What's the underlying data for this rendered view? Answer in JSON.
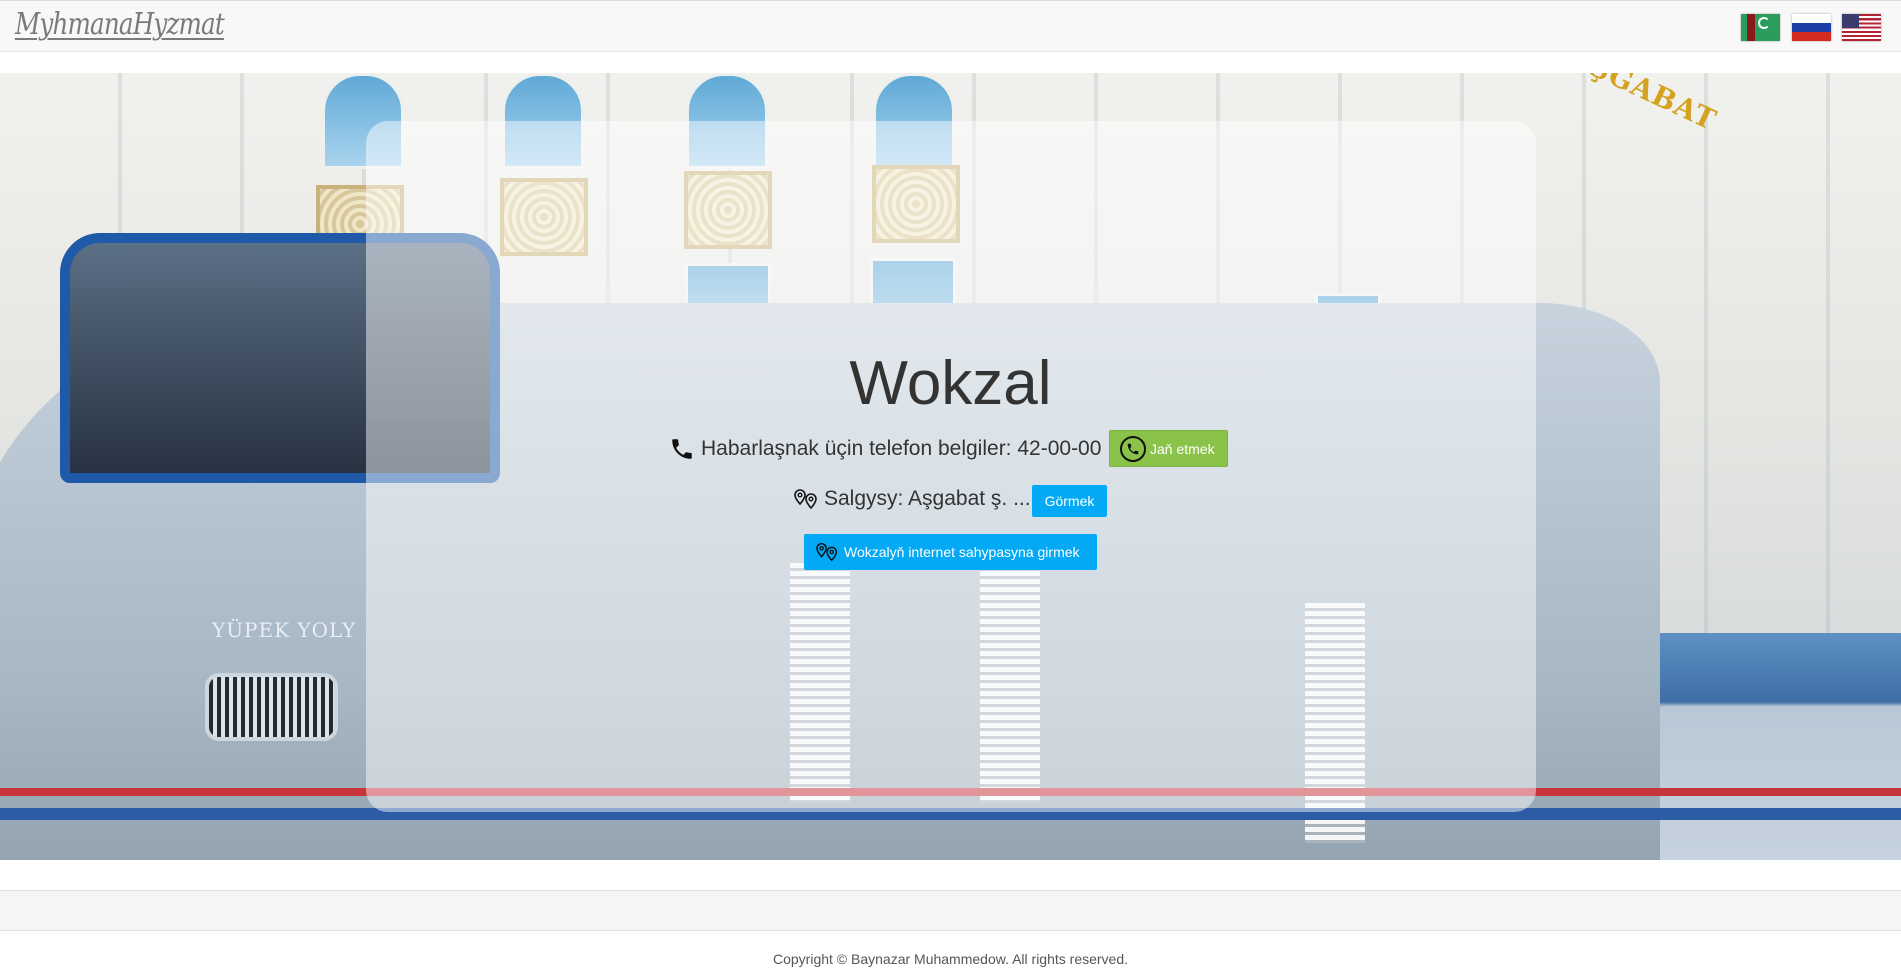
{
  "navbar": {
    "brand": "MyhmanaHyzmat",
    "flags": [
      {
        "name": "Turkmen",
        "colors": [
          "#2a9d5c",
          "#8b1a1a",
          "#ffffff"
        ]
      },
      {
        "name": "Russian",
        "colors": [
          "#ffffff",
          "#1c3fa8",
          "#d52b1e"
        ]
      },
      {
        "name": "English",
        "colors": [
          "#b22234",
          "#ffffff",
          "#3c3b6e"
        ]
      }
    ]
  },
  "hero": {
    "background_image": "railway station with train",
    "train_text": "YÜPEK YOLY",
    "sign_text": "AŞGABAT"
  },
  "content": {
    "title": "Wokzal",
    "phone_label": "Habarlaşnak üçin telefon belgiler: 42-00-00",
    "call_button": "Jaň etmek",
    "location_label": "Salgysy: Aşgabat ş. ...",
    "see_button": "Görmek",
    "website_button": "Wokzalyň internet sahypasyna girmek"
  },
  "footer": {
    "copyright": "Copyright © Baynazar Muhammedow. All rights reserved."
  },
  "colors": {
    "call_button": "#8bc34a",
    "info_button": "#03a9f4",
    "navbar_bg": "#f8f8f8"
  }
}
